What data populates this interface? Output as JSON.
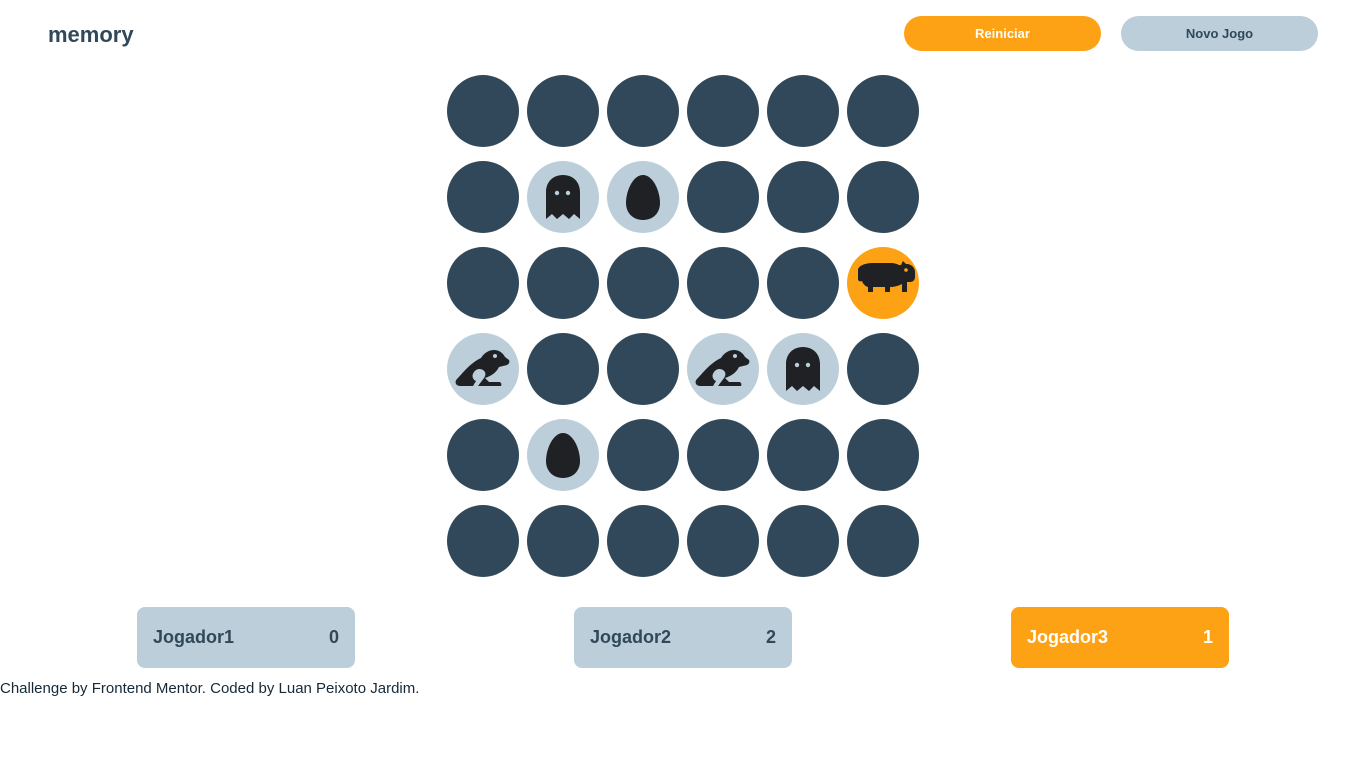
{
  "header": {
    "logo": "memory",
    "restart_label": "Reiniciar",
    "new_game_label": "Novo Jogo"
  },
  "board": {
    "cols": 6,
    "rows": 6,
    "tiles": [
      {
        "state": "hidden"
      },
      {
        "state": "hidden"
      },
      {
        "state": "hidden"
      },
      {
        "state": "hidden"
      },
      {
        "state": "hidden"
      },
      {
        "state": "hidden"
      },
      {
        "state": "hidden"
      },
      {
        "state": "matched",
        "icon": "ghost-icon"
      },
      {
        "state": "matched",
        "icon": "egg-icon"
      },
      {
        "state": "hidden"
      },
      {
        "state": "hidden"
      },
      {
        "state": "hidden"
      },
      {
        "state": "hidden"
      },
      {
        "state": "hidden"
      },
      {
        "state": "hidden"
      },
      {
        "state": "hidden"
      },
      {
        "state": "hidden"
      },
      {
        "state": "active",
        "icon": "hippo-icon"
      },
      {
        "state": "matched",
        "icon": "frog-icon"
      },
      {
        "state": "hidden"
      },
      {
        "state": "hidden"
      },
      {
        "state": "matched",
        "icon": "frog-icon"
      },
      {
        "state": "matched",
        "icon": "ghost-icon"
      },
      {
        "state": "hidden"
      },
      {
        "state": "hidden"
      },
      {
        "state": "matched",
        "icon": "egg-icon"
      },
      {
        "state": "hidden"
      },
      {
        "state": "hidden"
      },
      {
        "state": "hidden"
      },
      {
        "state": "hidden"
      },
      {
        "state": "hidden"
      },
      {
        "state": "hidden"
      },
      {
        "state": "hidden"
      },
      {
        "state": "hidden"
      },
      {
        "state": "hidden"
      },
      {
        "state": "hidden"
      }
    ]
  },
  "players": [
    {
      "name": "Jogador1",
      "score": "0",
      "current": false
    },
    {
      "name": "Jogador2",
      "score": "2",
      "current": false
    },
    {
      "name": "Jogador3",
      "score": "1",
      "current": true
    }
  ],
  "footer": {
    "credit": "Challenge by Frontend Mentor. Coded by Luan Peixoto Jardim."
  },
  "colors": {
    "accent": "#fda214",
    "hidden_tile": "#304859",
    "matched_tile": "#bcced9",
    "icon": "#1f2124"
  }
}
